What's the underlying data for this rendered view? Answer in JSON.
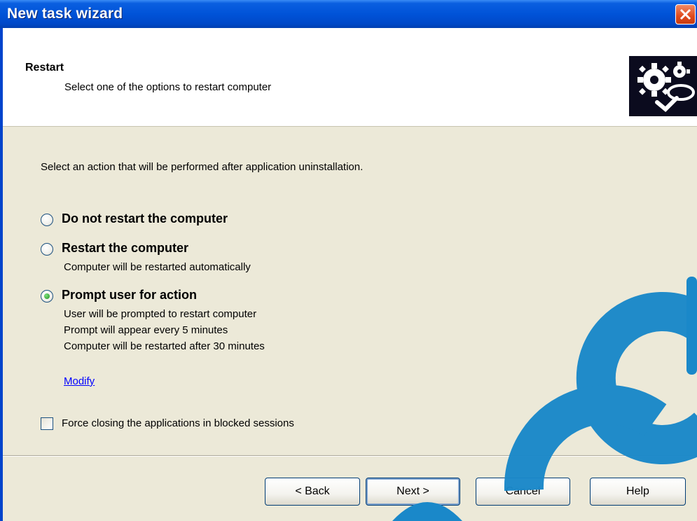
{
  "window": {
    "title": "New task wizard"
  },
  "header": {
    "title": "Restart",
    "subtitle": "Select one of the options to restart computer",
    "icon": "gears-icon"
  },
  "content": {
    "instruction": "Select an action that will be performed after application uninstallation.",
    "options": [
      {
        "label": "Do not restart the computer",
        "checked": false,
        "details": []
      },
      {
        "label": "Restart the computer",
        "checked": false,
        "details": [
          "Computer will be restarted automatically"
        ]
      },
      {
        "label": "Prompt user for action",
        "checked": true,
        "details": [
          "User will be prompted to restart computer",
          "Prompt will appear every 5 minutes",
          "Computer will be restarted after 30 minutes"
        ]
      }
    ],
    "modify_link": "Modify",
    "force_close_label": "Force closing the applications in blocked sessions",
    "force_close_checked": false
  },
  "buttons": {
    "back": "< Back",
    "next": "Next >",
    "cancel": "Cancel",
    "help": "Help"
  },
  "colors": {
    "titlebar": "#0053d8",
    "dialog_bg": "#ece9d8",
    "link": "#0000ff",
    "watermark": "#1a88c9"
  }
}
